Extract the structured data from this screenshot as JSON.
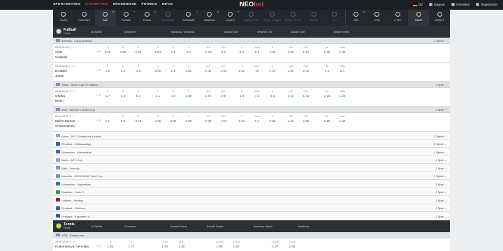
{
  "topnav": {
    "items": [
      "SPORTWETTEN",
      "LIVEWETTEN",
      "ERGEBNISSE",
      "PROMOS",
      "INFOS"
    ],
    "active": 1
  },
  "logo": {
    "prefix": "NEO",
    "suffix": "bet"
  },
  "topright": {
    "lang": "DE",
    "support": "Support",
    "login": "Anmelden",
    "register": "Registrieren"
  },
  "sports": [
    {
      "label": "Suche",
      "icon": "search-icon",
      "count": "",
      "state": "normal"
    },
    {
      "label": "Favoriten",
      "icon": "star-icon",
      "count": "",
      "state": "normal"
    },
    {
      "label": "Alle",
      "icon": "all-icon",
      "count": "34",
      "state": "active"
    },
    {
      "label": "Fußball",
      "icon": "soccer-icon",
      "count": "9",
      "state": "normal"
    },
    {
      "label": "Tennis",
      "icon": "tennis-icon",
      "count": "14",
      "state": "normal"
    },
    {
      "label": "Basketball",
      "icon": "basketball-icon",
      "count": "",
      "state": "dim"
    },
    {
      "label": "Volleyball",
      "icon": "volleyball-icon",
      "count": "2",
      "state": "normal"
    },
    {
      "label": "Baseball",
      "icon": "baseball-icon",
      "count": "5",
      "state": "normal"
    },
    {
      "label": "Cricket",
      "icon": "cricket-icon",
      "count": "12",
      "state": "normal"
    },
    {
      "label": "Rugby Union",
      "icon": "rugby-icon",
      "count": "",
      "state": "dim"
    },
    {
      "label": "Rugby League",
      "icon": "rugby-league-icon",
      "count": "",
      "state": "dim"
    },
    {
      "label": "Aussie Rules",
      "icon": "aussie-rules-icon",
      "count": "",
      "state": "dim"
    },
    {
      "label": "Boxen",
      "icon": "boxing-icon",
      "count": "",
      "state": "dim"
    },
    {
      "label": "A-Z",
      "icon": "az-icon",
      "count": "",
      "state": "dim"
    },
    {
      "label": "Alle",
      "icon": "clock-all-icon",
      "count": "34",
      "state": "sep"
    },
    {
      "label": "Jetzt",
      "icon": "clock-now-icon",
      "count": "",
      "state": "normal"
    },
    {
      "label": "3 Std.",
      "icon": "clock-3h-icon",
      "count": "",
      "state": "normal"
    },
    {
      "label": "Heute",
      "icon": "clock-today-icon",
      "count": "",
      "state": "active"
    },
    {
      "label": "Weitere",
      "icon": "more-icon",
      "count": "",
      "state": "normal"
    }
  ],
  "soccer": {
    "title": "Fußball",
    "subtitle": "Heute",
    "cols": [
      "26 Spiele",
      "Gewinner",
      "Handicap / Bestand",
      "Anzahl Tore",
      "Welches Tor",
      "Anzahl Tore",
      "Beide treffen"
    ],
    "col_x": [
      54,
      102,
      168,
      245,
      292,
      340,
      402
    ]
  },
  "tennis": {
    "title": "Tennis",
    "subtitle": "Heute",
    "cols": [
      "14 Spiele",
      "Gewinner",
      "Anzahl Spiele",
      "Anzahl Spiele",
      "Handicap Spiele",
      "Handicap"
    ],
    "col_x": [
      54,
      102,
      168,
      220,
      286,
      350
    ]
  },
  "leagues_top": [
    {
      "name": "Amerika - Copa America",
      "right": "2 Spiele",
      "events": [
        {
          "time": "25.06 01:00",
          "t1": "Chile",
          "t2": "Uruguay",
          "more": "+ 67",
          "odds": [
            [
              "1",
              "3.25"
            ],
            [
              "X",
              "3.35"
            ],
            [
              "2",
              "2.24"
            ],
            [
              "1",
              "1.84"
            ],
            [
              "2",
              "3.8"
            ],
            [
              "X",
              "4.4"
            ],
            [
              "-2.5",
              "1.75"
            ],
            [
              "2.5+",
              "2.0"
            ],
            [
              "1",
              "2.2"
            ],
            [
              "Kein",
              "8.3"
            ],
            [
              "2",
              "1.84"
            ],
            [
              "-2.5",
              "2.25"
            ],
            [
              "2.5+",
              "1.51"
            ],
            [
              "Ja",
              "1.78"
            ],
            [
              "Nein",
              "1.96"
            ]
          ]
        },
        {
          "time": "25.06 01:30",
          "t1": "Ecuador",
          "t2": "Japan",
          "more": "+ 72",
          "odds": [
            [
              "1",
              "1.8"
            ],
            [
              "X",
              "4.2"
            ],
            [
              "2",
              "3.8"
            ],
            [
              "1",
              "3.95"
            ],
            [
              "X",
              "2.6"
            ],
            [
              "2",
              "2.82"
            ],
            [
              "-2.5",
              "2.42"
            ],
            [
              "2.5+",
              "1.52"
            ],
            [
              "1",
              "1.62"
            ],
            [
              "Kein",
              "16"
            ],
            [
              "2",
              "2.44"
            ],
            [
              "-2.5",
              "1.52"
            ],
            [
              "2.5+",
              "2.42"
            ],
            [
              "Ja",
              "1.5"
            ],
            [
              "Nein",
              "2.4"
            ]
          ]
        }
      ]
    },
    {
      "name": "Afrika - Africa Cup Of Nations",
      "right": "1 Spiel",
      "events": [
        {
          "time": "25.06 22:00",
          "t1": "Ghana",
          "t2": "Benin",
          "more": "+ 70",
          "odds": [
            [
              "1",
              "1.7"
            ],
            [
              "X",
              "3.5"
            ],
            [
              "2",
              "6.1"
            ],
            [
              "1",
              "2.1"
            ],
            [
              "X",
              "4.2"
            ],
            [
              "2",
              "2.85"
            ],
            [
              "-2.5",
              "1.94"
            ],
            [
              "2.5+",
              "2.9"
            ],
            [
              "1",
              "1.6"
            ],
            [
              "Kein",
              "7.5"
            ],
            [
              "2",
              "4.1"
            ],
            [
              "-2.5",
              "2.64"
            ],
            [
              "2.5+",
              "1.42"
            ],
            [
              "Ja",
              "2.18"
            ],
            [
              "Nein",
              "1.64"
            ]
          ]
        }
      ]
    },
    {
      "name": "Welt - Women's World Cup",
      "right": "1 Spiel",
      "events": [
        {
          "time": "25.06 18:00",
          "t1": "Italien Damen",
          "t2": "China Damen",
          "more": "+ 70",
          "odds": [
            [
              "1",
              "2.1"
            ],
            [
              "X",
              "3.0"
            ],
            [
              "2",
              "3.75"
            ],
            [
              "1",
              "4.05"
            ],
            [
              "X",
              "3.45"
            ],
            [
              "2",
              "1.85"
            ],
            [
              "-2.5",
              "2.36"
            ],
            [
              "2.5+",
              "1.52"
            ],
            [
              "1",
              "1.94"
            ],
            [
              "Kein",
              "6.4"
            ],
            [
              "2",
              "2.56"
            ],
            [
              "-2.5",
              "1.45"
            ],
            [
              "2.5+",
              "2.55"
            ],
            [
              "Ja",
              "2.15"
            ],
            [
              "Nein",
              "1.62"
            ]
          ]
        }
      ]
    }
  ],
  "leagues_simple": [
    {
      "name": "Asien - AFC Champions League",
      "right": "2 Spiele",
      "flag": "#9aa6b4"
    },
    {
      "name": "Finnland - Veikkausliiga",
      "right": "5 Spiele",
      "flag": "#2a5fb5"
    },
    {
      "name": "Schweden - Allsvenskan",
      "right": "2 Spiele",
      "flag": "#2a6fc0"
    },
    {
      "name": "Asien - AFC Cup",
      "right": "1 Spiel",
      "flag": "#9aa6b4"
    },
    {
      "name": "Welt - Friendly",
      "right": "1 Spiel",
      "flag": "#7a95b8"
    },
    {
      "name": "Amerika - CONCACAF Gold Cup",
      "right": "2 Spiele",
      "flag": "#7a95b8"
    },
    {
      "name": "Schweden - Superettan",
      "right": "1 Spiel",
      "flag": "#2a6fc0"
    },
    {
      "name": "Brasilien - Serie C",
      "right": "1 Spiel",
      "flag": "#2b9a3e"
    },
    {
      "name": "Lettland - Virsliga",
      "right": "1 Spiel",
      "flag": "#9b2335"
    },
    {
      "name": "Finnland - Ykkönen",
      "right": "1 Spiel",
      "flag": "#2a5fb5"
    },
    {
      "name": "Finnland - Kakkonen A",
      "right": "1 Spiel",
      "flag": "#2a5fb5"
    }
  ],
  "tennis_leagues": [
    {
      "name": "WTA - Eastbourne",
      "right": "",
      "events": [
        {
          "time": "25.06 12:00",
          "t1": "Kudermetova, Veronika",
          "t2": "",
          "more": "+ 11",
          "odds": [
            [
              "1",
              "1.98"
            ],
            [
              "2",
              "1.74"
            ],
            [
              "-21.5",
              "1.82"
            ],
            [
              "21.5+",
              "1.98"
            ],
            [
              "1 (-3.5)",
              "1.88"
            ],
            [
              "2 (3.5)",
              "1.82"
            ],
            [
              "1 (-1.5)",
              "1.47"
            ],
            [
              "2 (1.5)",
              "2.68"
            ]
          ]
        }
      ]
    }
  ]
}
